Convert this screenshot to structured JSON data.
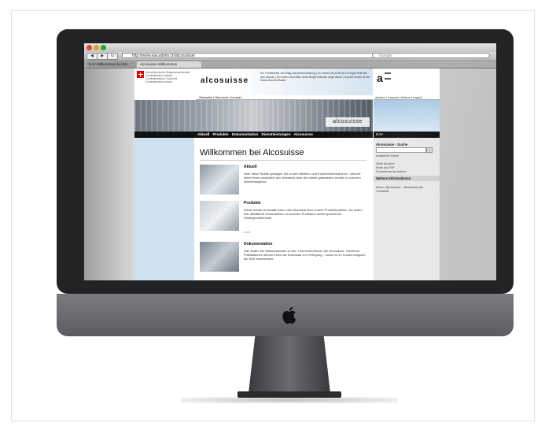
{
  "browser": {
    "url": "http://www.eav.admin.ch/alcosuisse/",
    "search_placeholder": "Google",
    "back_symbol": "◀",
    "forward_symbol": "▶",
    "reload_symbol": "↻",
    "plus_symbol": "+",
    "tabs": [
      {
        "label": "EAV Willkommen bei der"
      },
      {
        "label": "Alcosuisse Willkommen"
      }
    ]
  },
  "header": {
    "confederation_text": "Schweizerische Eidgenossenschaft Confédération suisse Confederazione Svizzera Confederaziun svizra",
    "brand": "alcosuisse",
    "brand_description": "Ein Profitcenter der Eidg. Alkoholverwaltung | Un centre de profit de la Régie fédérale des alcools | Un centro di profitto della Regia federale degli alcool | A profit centre of the Swiss Alcohol Board",
    "eav_logo": "a",
    "subnav": "Startseite | Übersicht | Kontakt",
    "languages": "deutsch | français | italiano | english",
    "photo_brand": "alcosuisse"
  },
  "main_nav": {
    "items": [
      "Aktuell",
      "Produkte",
      "Dokumentation",
      "Dienstleistungen",
      "Alcosuisse"
    ],
    "eav_label": "EAV"
  },
  "content": {
    "title": "Willkommen bei Alcosuisse",
    "items": [
      {
        "title": "Aktuell",
        "text": "Über diese Rubrik gelangen Sie zu den Medien- und Kundeninformationen. „Aktuell“ bietet Ihnen zusätzlich den Überblick über die zuletzt geänderten Inhalte in unserem Internetangebot.",
        "more": ""
      },
      {
        "title": "Produkte",
        "text": "Diese Rubrik verschafft Ihnen eine Übersicht über unsere Produktepalette. Sie finden hier detaillierte Informationen zu unseren Produkten sowie spannende Hintergrundberichte.",
        "more": "mehr"
      },
      {
        "title": "Dokumentation",
        "text": "Hier finden Sie Wissenswertes zu den Themenbereichen der Alcosuisse. Sämtliche Publikationen stehen Ihnen als Download zur Verfügung – sowie es im Kundenmagazin der EAV erschienene",
        "more": ""
      }
    ]
  },
  "sidebar": {
    "search_title": "Alcosuisse - Suche",
    "go_label": "»",
    "extended_search": "erweiterte Suche",
    "actions": [
      "Seite drucken",
      "Seite als PDF",
      "Kommentar an Autorin"
    ],
    "more_info_title": "Weitere Informationen",
    "more_info_items": [
      "ethan / Alcosuisse – Bioethanol als Treibstoff"
    ]
  },
  "colors": {
    "bezel": "#222325",
    "chin": "#6a6c70",
    "page_blue": "#cfe1ef",
    "nav_black": "#111111",
    "tl_red": "#e0443e",
    "tl_yellow": "#dea123",
    "tl_green": "#1aab29"
  }
}
